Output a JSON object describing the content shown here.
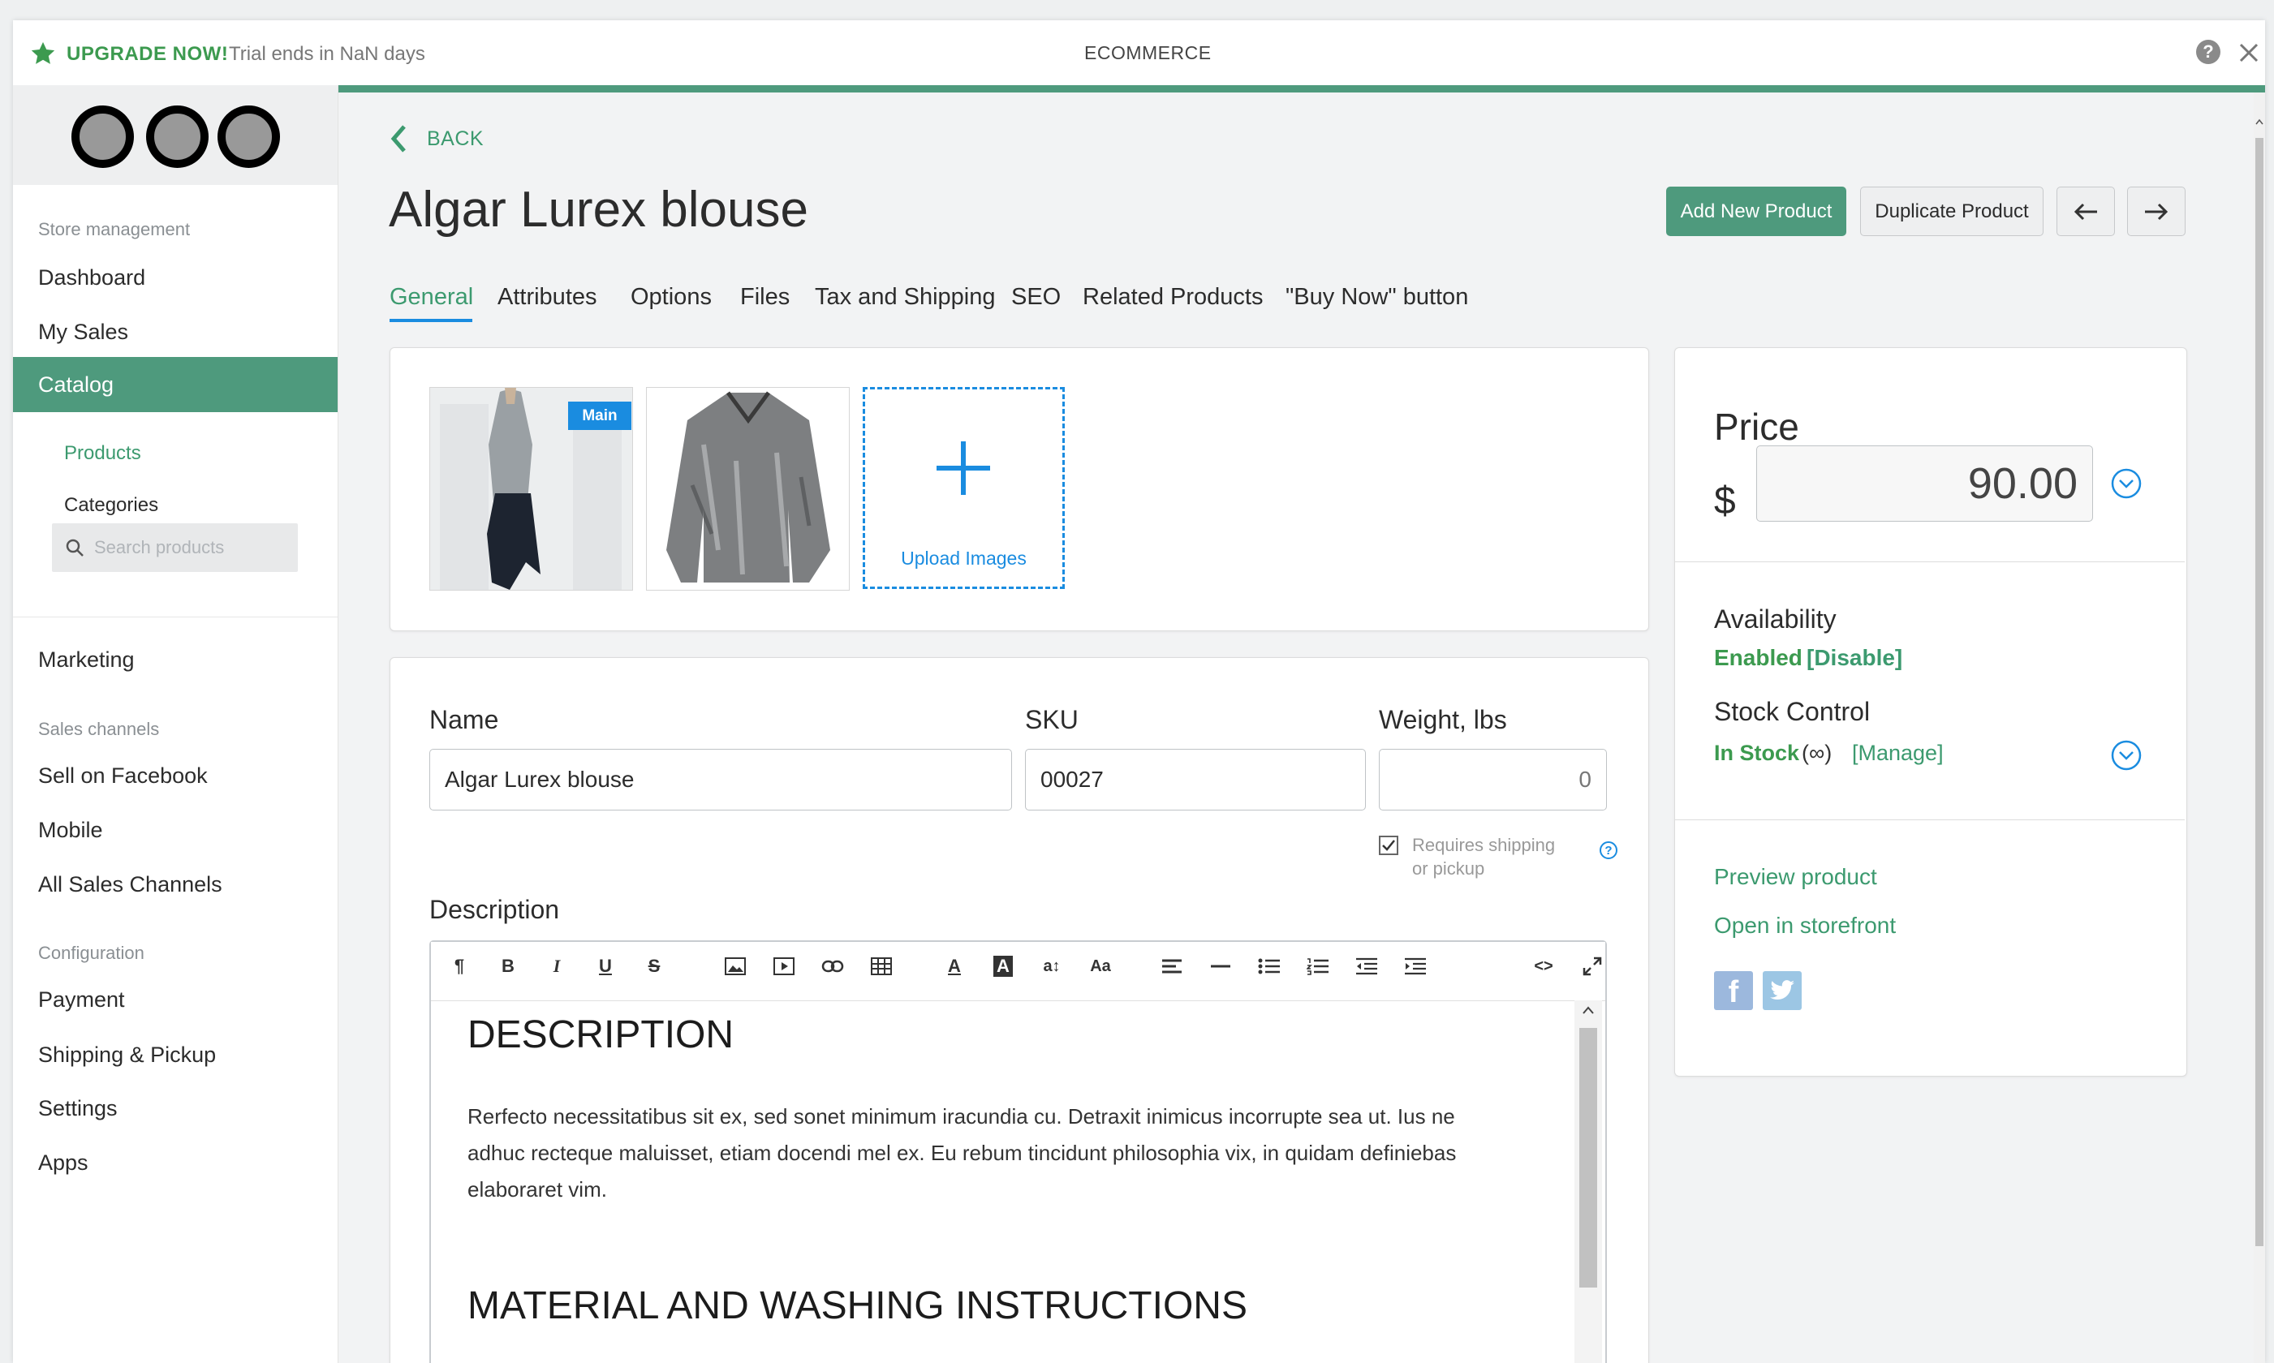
{
  "topbar": {
    "upgrade": "UPGRADE NOW!",
    "trial": "Trial ends in NaN days",
    "app_title": "ECOMMERCE"
  },
  "sidebar": {
    "store_management": "Store management",
    "dashboard": "Dashboard",
    "my_sales": "My Sales",
    "catalog": "Catalog",
    "products": "Products",
    "categories": "Categories",
    "search_placeholder": "Search products",
    "marketing": "Marketing",
    "sales_channels": "Sales channels",
    "sell_on_facebook": "Sell on Facebook",
    "mobile": "Mobile",
    "all_sales_channels": "All Sales Channels",
    "configuration": "Configuration",
    "payment": "Payment",
    "shipping_pickup": "Shipping & Pickup",
    "settings": "Settings",
    "apps": "Apps"
  },
  "header": {
    "back": "BACK",
    "title": "Algar Lurex blouse",
    "add_new_product": "Add New Product",
    "duplicate_product": "Duplicate Product"
  },
  "tabs": [
    "General",
    "Attributes",
    "Options",
    "Files",
    "Tax and Shipping",
    "SEO",
    "Related Products",
    "\"Buy Now\" button"
  ],
  "images": {
    "main_badge": "Main",
    "upload_label": "Upload Images"
  },
  "form": {
    "name_label": "Name",
    "name_value": "Algar Lurex blouse",
    "sku_label": "SKU",
    "sku_value": "00027",
    "weight_label": "Weight, lbs",
    "weight_value": "0",
    "requires_shipping_line1": "Requires shipping",
    "requires_shipping_line2": "or pickup",
    "description_label": "Description"
  },
  "editor": {
    "heading1": "DESCRIPTION",
    "paragraph_line1": "Rerfecto necessitatibus sit ex, sed sonet minimum iracundia cu. Detraxit inimicus incorrupte sea ut. Ius ne",
    "paragraph_line2": "adhuc recteque maluisset, etiam docendi mel ex. Eu rebum tincidunt philosophia vix, in quidam definiebas",
    "paragraph_line3": "elaboraret vim.",
    "heading2": "MATERIAL AND WASHING INSTRUCTIONS"
  },
  "price_panel": {
    "price_label": "Price",
    "currency": "$",
    "price_value": "90.00",
    "availability_label": "Availability",
    "enabled": "Enabled",
    "disable_link": "[Disable]",
    "stock_control_label": "Stock Control",
    "in_stock": "In Stock",
    "infinity": "(∞)",
    "manage_link": "[Manage]",
    "preview_product": "Preview product",
    "open_in_storefront": "Open in storefront"
  },
  "colors": {
    "accent": "#4e9a7d",
    "link": "#3c9a6f",
    "enabled_green": "#3c9a4f",
    "blue": "#1a8ce0"
  }
}
